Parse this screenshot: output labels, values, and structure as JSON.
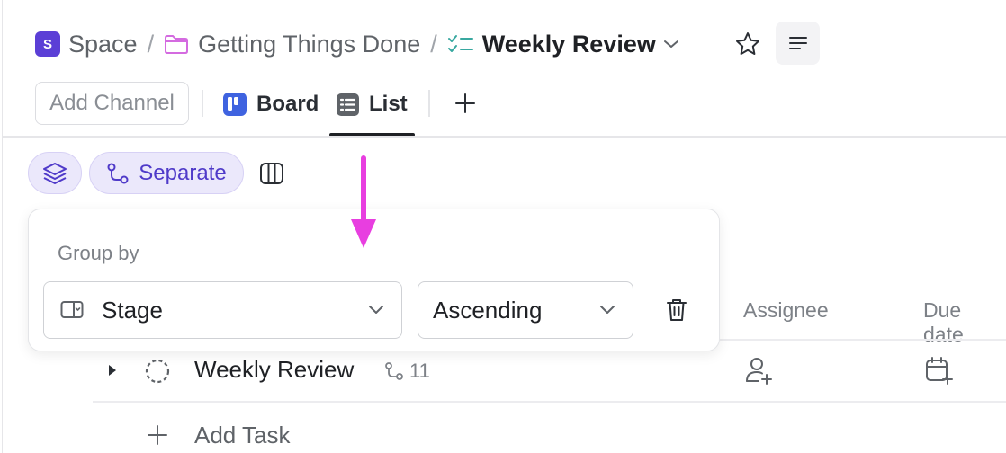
{
  "breadcrumb": {
    "space_badge": "S",
    "space": "Space",
    "separator": "/",
    "folder": "Getting Things Done",
    "current_list": "Weekly Review"
  },
  "views": {
    "add_channel": "Add Channel",
    "tabs": [
      {
        "label": "Board",
        "icon": "board-icon",
        "active": false
      },
      {
        "label": "List",
        "icon": "list-view-icon",
        "active": true
      }
    ]
  },
  "toolbar": {
    "separate_label": "Separate"
  },
  "table": {
    "columns": [
      "Assignee",
      "Due date"
    ],
    "task": {
      "name": "Weekly Review",
      "subtask_count": "11"
    },
    "add_task_label": "Add Task"
  },
  "group_by_popover": {
    "title": "Group by",
    "field": "Stage",
    "order": "Ascending"
  },
  "colors": {
    "accent": "#4f3ac9",
    "accent_bg": "#ebe8fb",
    "annotation_arrow": "#e83ee0"
  }
}
